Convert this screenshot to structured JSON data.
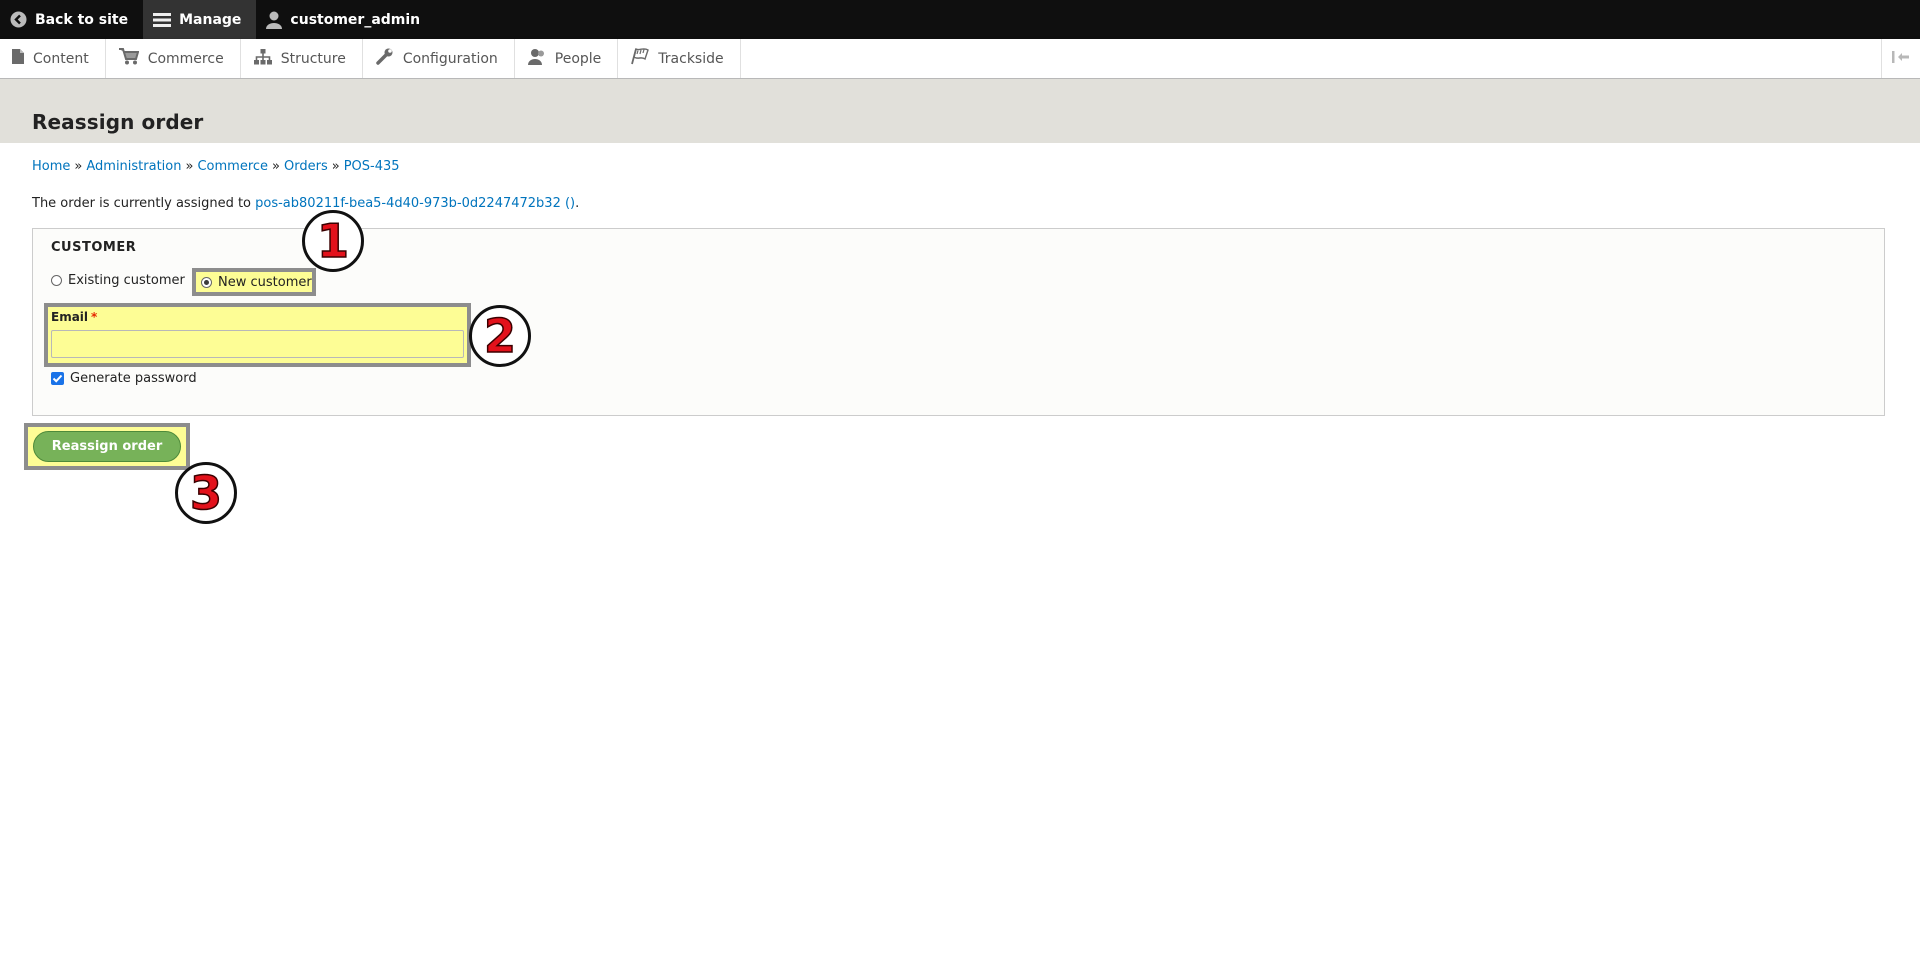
{
  "toolbar": {
    "back_to_site": "Back to site",
    "manage": "Manage",
    "user": "customer_admin"
  },
  "tray": {
    "items": [
      {
        "label": "Content",
        "icon": "file-icon"
      },
      {
        "label": "Commerce",
        "icon": "cart-icon"
      },
      {
        "label": "Structure",
        "icon": "sitemap-icon"
      },
      {
        "label": "Configuration",
        "icon": "wrench-icon"
      },
      {
        "label": "People",
        "icon": "people-icon"
      },
      {
        "label": "Trackside",
        "icon": "flag-icon"
      }
    ]
  },
  "page": {
    "title": "Reassign order"
  },
  "breadcrumb": {
    "items": [
      "Home",
      "Administration",
      "Commerce",
      "Orders",
      "POS-435"
    ],
    "separator": "»"
  },
  "assignment": {
    "prefix": "The order is currently assigned to ",
    "link": "pos-ab80211f-bea5-4d40-973b-0d2247472b32 ()",
    "suffix": "."
  },
  "customer": {
    "legend": "CUSTOMER",
    "options": [
      "Existing customer",
      "New customer"
    ],
    "selected": "New customer",
    "email_label": "Email",
    "required_marker": "*",
    "email_value": "",
    "generate_password_label": "Generate password",
    "generate_password_checked": true
  },
  "actions": {
    "submit_label": "Reassign order"
  },
  "callouts": [
    "1",
    "2",
    "3"
  ],
  "colors": {
    "highlight": "#fdfd95",
    "button": "#77b259",
    "link": "#0074bd",
    "callout_number": "#e3111b"
  }
}
